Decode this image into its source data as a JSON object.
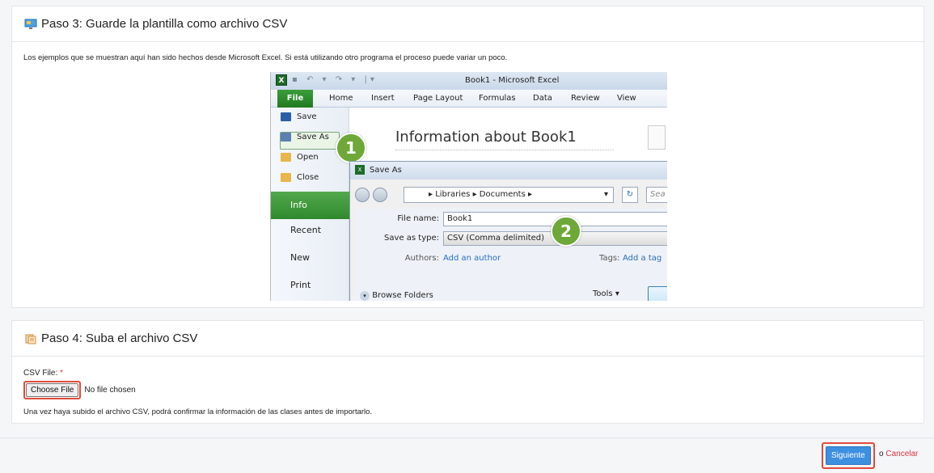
{
  "step3": {
    "title": "Paso 3: Guarde la plantilla como archivo CSV",
    "description": "Los ejemplos que se muestran aquí han sido hechos desde Microsoft Excel. Si está utilizando otro programa el proceso puede variar un poco."
  },
  "excel": {
    "window_title": "Book1  -  Microsoft Excel",
    "app_icon": "X",
    "ribbon_tabs": [
      "File",
      "Home",
      "Insert",
      "Page Layout",
      "Formulas",
      "Data",
      "Review",
      "View"
    ],
    "backstage_items": [
      "Save",
      "Save As",
      "Open",
      "Close"
    ],
    "backstage_nav": [
      "Info",
      "Recent",
      "New",
      "Print"
    ],
    "info_title": "Information about Book1",
    "dialog": {
      "title": "Save As",
      "path": [
        "Libraries",
        "Documents"
      ],
      "search_placeholder": "Sea",
      "file_name_label": "File name:",
      "file_name_value": "Book1",
      "save_type_label": "Save as type:",
      "save_type_value": "CSV (Comma delimited)",
      "authors_label": "Authors:",
      "authors_value": "Add an author",
      "tags_label": "Tags:",
      "tags_value": "Add a tag",
      "browse_folders": "Browse Folders",
      "tools": "Tools"
    },
    "badges": [
      "1",
      "2"
    ]
  },
  "step4": {
    "title": "Paso 4: Suba el archivo CSV",
    "csv_label": "CSV File:",
    "required_mark": "*",
    "choose_file": "Choose File",
    "no_file": "No file chosen",
    "note": "Una vez haya subido el archivo CSV, podrá confirmar la información de las clases antes de importarlo."
  },
  "footer": {
    "next": "Siguiente",
    "or": "o",
    "cancel": "Cancelar"
  },
  "colors": {
    "primary": "#3d8fe0",
    "highlight_border": "#e04b3c",
    "cancel": "#d9363e",
    "excel_green": "#2f8a2d"
  }
}
